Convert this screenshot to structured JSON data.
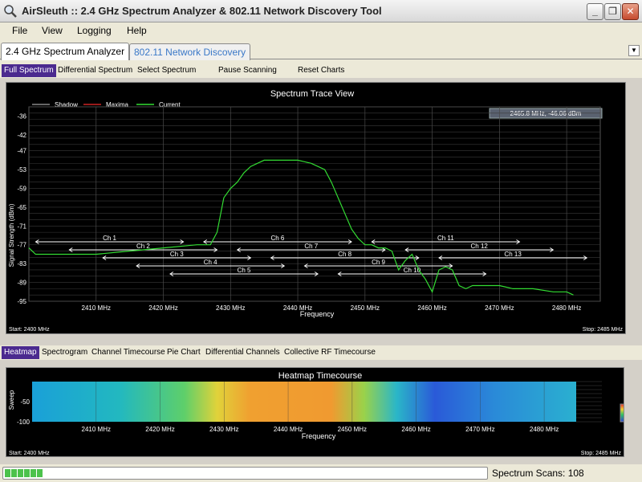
{
  "window": {
    "title": "AirSleuth :: 2.4 GHz Spectrum Analyzer & 802.11 Network Discovery Tool",
    "minimize_label": "_",
    "restore_label": "❐",
    "close_label": "✕"
  },
  "menu": [
    {
      "label": "File"
    },
    {
      "label": "View"
    },
    {
      "label": "Logging"
    },
    {
      "label": "Help"
    }
  ],
  "main_tabs": [
    {
      "label": "2.4 GHz Spectrum Analyzer",
      "active": true
    },
    {
      "label": "802.11 Network Discovery",
      "active": false
    }
  ],
  "spectrum_tabs": [
    {
      "label": "Full Spectrum",
      "active": true
    },
    {
      "label": "Differential Spectrum",
      "active": false
    },
    {
      "label": "Select Spectrum",
      "active": false
    },
    {
      "label": "Pause Scanning",
      "active": false
    },
    {
      "label": "Reset Charts",
      "active": false
    }
  ],
  "bottom_tabs": [
    {
      "label": "Heatmap",
      "active": true
    },
    {
      "label": "Spectrogram",
      "active": false
    },
    {
      "label": "Channel Timecourse",
      "active": false
    },
    {
      "label": "Pie Chart",
      "active": false
    },
    {
      "label": "Differential Channels",
      "active": false
    },
    {
      "label": "Collective RF Timecourse",
      "active": false
    }
  ],
  "status": {
    "scans_label": "Spectrum Scans: 108",
    "progress_blocks": 6
  },
  "colors": {
    "shadow": "#888888",
    "maxima": "#cc2222",
    "current": "#33dd33",
    "channel_line": "#ffffff",
    "active_tab": "#4b2a8f",
    "inactive_tab_text": "#3a78c8"
  },
  "chart_data": [
    {
      "type": "line",
      "title": "Spectrum Trace View",
      "xlabel": "Frequency",
      "ylabel": "Signal Strength (dBm)",
      "xlim": [
        2400,
        2485
      ],
      "ylim": [
        -95,
        -33
      ],
      "grid": true,
      "legend_position": "top-left",
      "legend": [
        "Shadow",
        "Maxima",
        "Current"
      ],
      "readout": "2465.8 MHz,  -46.06 dBm",
      "start_label": "Start: 2400 MHz",
      "stop_label": "Stop: 2485 MHz",
      "x_ticks": [
        {
          "value": 2410,
          "label": "2410 MHz"
        },
        {
          "value": 2420,
          "label": "2420 MHz"
        },
        {
          "value": 2430,
          "label": "2430 MHz"
        },
        {
          "value": 2440,
          "label": "2440 MHz"
        },
        {
          "value": 2450,
          "label": "2450 MHz"
        },
        {
          "value": 2460,
          "label": "2460 MHz"
        },
        {
          "value": 2470,
          "label": "2470 MHz"
        },
        {
          "value": 2480,
          "label": "2480 MHz"
        }
      ],
      "y_ticks": [
        -36,
        -42,
        -47,
        -53,
        -59,
        -65,
        -71,
        -77,
        -83,
        -89,
        -95
      ],
      "series": [
        {
          "name": "Current",
          "x": [
            2400,
            2401,
            2403,
            2406,
            2410,
            2415,
            2420,
            2425,
            2427,
            2428,
            2429,
            2430,
            2431,
            2432,
            2433,
            2434,
            2435,
            2436,
            2437,
            2438,
            2440,
            2442,
            2444,
            2445,
            2446,
            2447,
            2448,
            2449,
            2450,
            2451,
            2452,
            2453,
            2454,
            2455,
            2456,
            2457,
            2458,
            2459,
            2460,
            2461,
            2462,
            2463,
            2464,
            2465,
            2466,
            2468,
            2470,
            2472,
            2475,
            2478,
            2480,
            2481
          ],
          "y": [
            -78,
            -80,
            -80,
            -80,
            -80,
            -79,
            -78,
            -77,
            -77,
            -73,
            -62,
            -59,
            -57,
            -54,
            -52,
            -51,
            -50,
            -50,
            -50,
            -50,
            -50,
            -51,
            -53,
            -57,
            -62,
            -67,
            -72,
            -75,
            -77,
            -77,
            -78,
            -78,
            -79,
            -85,
            -82,
            -80,
            -85,
            -88,
            -92,
            -85,
            -84,
            -85,
            -90,
            -91,
            -90,
            -90,
            -90,
            -91,
            -91,
            -92,
            -92,
            -93
          ]
        }
      ],
      "channels": [
        {
          "label": "Ch 1",
          "start": 2401,
          "end": 2423
        },
        {
          "label": "Ch 2",
          "start": 2406,
          "end": 2428
        },
        {
          "label": "Ch 3",
          "start": 2411,
          "end": 2433
        },
        {
          "label": "Ch 4",
          "start": 2416,
          "end": 2438
        },
        {
          "label": "Ch 5",
          "start": 2421,
          "end": 2443
        },
        {
          "label": "Ch 6",
          "start": 2426,
          "end": 2448
        },
        {
          "label": "Ch 7",
          "start": 2431,
          "end": 2453
        },
        {
          "label": "Ch 8",
          "start": 2436,
          "end": 2458
        },
        {
          "label": "Ch 9",
          "start": 2441,
          "end": 2463
        },
        {
          "label": "Ch 10",
          "start": 2446,
          "end": 2468
        },
        {
          "label": "Ch 11",
          "start": 2451,
          "end": 2473
        },
        {
          "label": "Ch 12",
          "start": 2456,
          "end": 2478
        },
        {
          "label": "Ch 13",
          "start": 2461,
          "end": 2483
        }
      ]
    },
    {
      "type": "heatmap",
      "title": "Heatmap Timecourse",
      "xlabel": "Frequency",
      "ylabel": "Sweep",
      "xlim": [
        2400,
        2485
      ],
      "ylim": [
        0,
        -100
      ],
      "y_ticks": [
        -100,
        -50
      ],
      "start_label": "Start: 2400 MHz",
      "stop_label": "Stop: 2485 MHz",
      "x_ticks": [
        {
          "value": 2410,
          "label": "2410 MHz"
        },
        {
          "value": 2420,
          "label": "2420 MHz"
        },
        {
          "value": 2430,
          "label": "2430 MHz"
        },
        {
          "value": 2440,
          "label": "2440 MHz"
        },
        {
          "value": 2450,
          "label": "2450 MHz"
        },
        {
          "value": 2460,
          "label": "2460 MHz"
        },
        {
          "value": 2470,
          "label": "2470 MHz"
        },
        {
          "value": 2480,
          "label": "2480 MHz"
        }
      ]
    }
  ]
}
